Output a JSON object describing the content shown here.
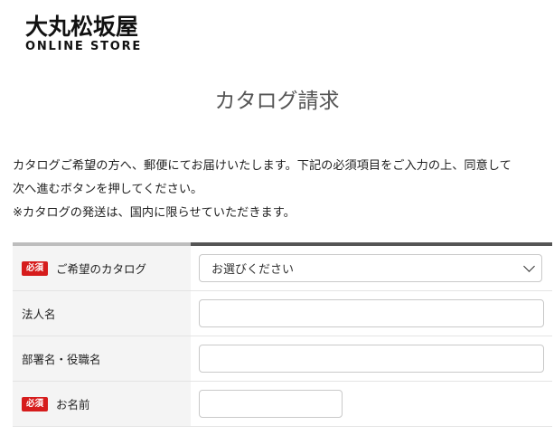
{
  "logo": {
    "jp": "大丸松坂屋",
    "en": "ONLINE STORE"
  },
  "page": {
    "title": "カタログ請求"
  },
  "intro": {
    "line1": "カタログご希望の方へ、郵便にてお届けいたします。下記の必須項目をご入力の上、同意して",
    "line2": "次へ進むボタンを押してください。",
    "line3": "※カタログの発送は、国内に限らせていただきます。"
  },
  "form": {
    "required_badge": "必須",
    "catalog": {
      "label": "ご希望のカタログ",
      "selected": "お選びください",
      "required": true
    },
    "company": {
      "label": "法人名",
      "value": "",
      "required": false
    },
    "department": {
      "label": "部署名・役職名",
      "value": "",
      "required": false
    },
    "name": {
      "label": "お名前",
      "value": "",
      "required": true
    }
  }
}
